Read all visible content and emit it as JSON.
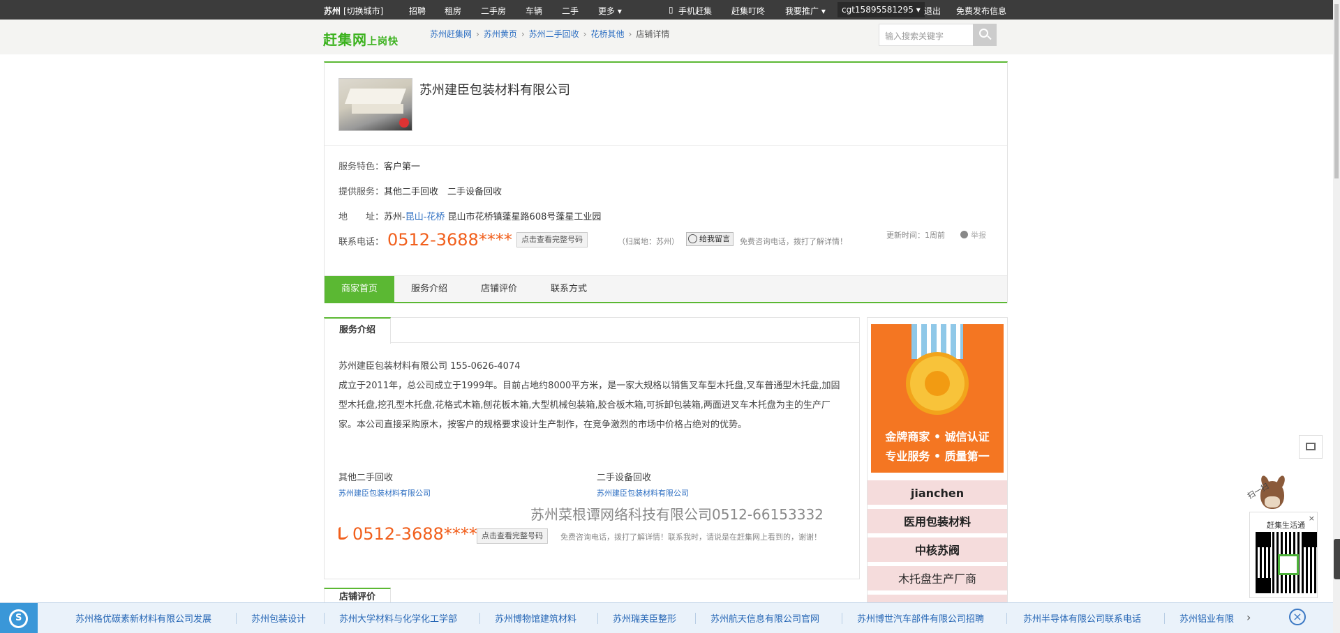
{
  "topbar": {
    "city": "苏州",
    "switch_city": "[切换城市]",
    "nav": [
      "招聘",
      "租房",
      "二手房",
      "车辆",
      "二手",
      "更多 ▾"
    ],
    "mobile": "手机赶集",
    "app": "赶集叮咚",
    "promote": "我要推广 ▾",
    "username": "cgt15895581295 ▾",
    "logout": "退出",
    "publish": "免费发布信息"
  },
  "header": {
    "logo": "赶集网",
    "logo_slogan": "上岗快",
    "breadcrumb": [
      "苏州赶集网",
      "苏州黄页",
      "苏州二手回收",
      "花桥其他"
    ],
    "breadcrumb_current": "店铺详情",
    "search_placeholder": "输入搜索关键字"
  },
  "shop": {
    "name": "苏州建臣包装材料有限公司",
    "feature_label": "服务特色：",
    "feature_value": "客户第一",
    "service_label": "提供服务：",
    "service_value": "其他二手回收　二手设备回收",
    "address_label": "地　　址：",
    "address_city": "苏州-",
    "address_area": "昆山-花桥",
    "address_detail": " 昆山市花桥镇蓬星路608号蓬星工业园",
    "phone_label": "联系电话：",
    "phone": "0512-3688****",
    "view_full": "点击查看完整号码",
    "belong": "（归属地：苏州）",
    "message_btn": "给我留言",
    "free_tip": "免费咨询电话，拨打了解详情！",
    "update": "更新时间：1周前",
    "report": "举报",
    "tabs": [
      "商家首页",
      "服务介绍",
      "店铺评价",
      "联系方式"
    ]
  },
  "service": {
    "heading": "服务介绍",
    "intro_title": "苏州建臣包装材料有限公司  155-0626-4074",
    "intro_body": "成立于2011年，总公司成立于1999年。目前占地约8000平方米，是一家大规格以销售叉车型木托盘,叉车普通型木托盘,加固型木托盘,挖孔型木托盘,花格式木箱,刨花板木箱,大型机械包装箱,胶合板木箱,可拆卸包装箱,两面进叉车木托盘为主的生产厂家。本公司直接采购原木，按客户的规格要求设计生产制作，在竞争激烈的市场中价格占绝对的优势。",
    "cat1": "其他二手回收",
    "cat1_link": "苏州建臣包装材料有限公司",
    "cat2": "二手设备回收",
    "cat2_link": "苏州建臣包装材料有限公司",
    "watermark": "苏州菜根谭网络科技有限公司0512-66153332",
    "phone": "0512-3688****",
    "view_full": "点击查看完整号码",
    "tip": "免费咨询电话，拨打了解详情！联系我时，请说是在赶集网上看到的，谢谢！",
    "review_heading": "店铺评价"
  },
  "sidebar": {
    "medal_line1": "金牌商家 • 诚信认证",
    "medal_line2": "专业服务 • 质量第一",
    "tags": [
      "jianchen",
      "医用包装材料",
      "中核苏阀",
      "木托盘生产厂商"
    ]
  },
  "float": {
    "qr_title": "赶集生活通",
    "scan": "扫一扫",
    "close": "×"
  },
  "bottombar": {
    "links": [
      "苏州格优碳素新材料有限公司发展",
      "苏州包装设计",
      "苏州大学材料与化学化工学部",
      "苏州博物馆建筑材料",
      "苏州瑞芙臣整形",
      "苏州航天信息有限公司官网",
      "苏州博世汽车部件有限公司招聘",
      "苏州半导体有限公司联系电话",
      "苏州铝业有限"
    ],
    "next": "›",
    "close": "×"
  },
  "colors": {
    "brand_green": "#5bb833",
    "phone_orange": "#f15f1c",
    "link_blue": "#2c6ec2"
  }
}
